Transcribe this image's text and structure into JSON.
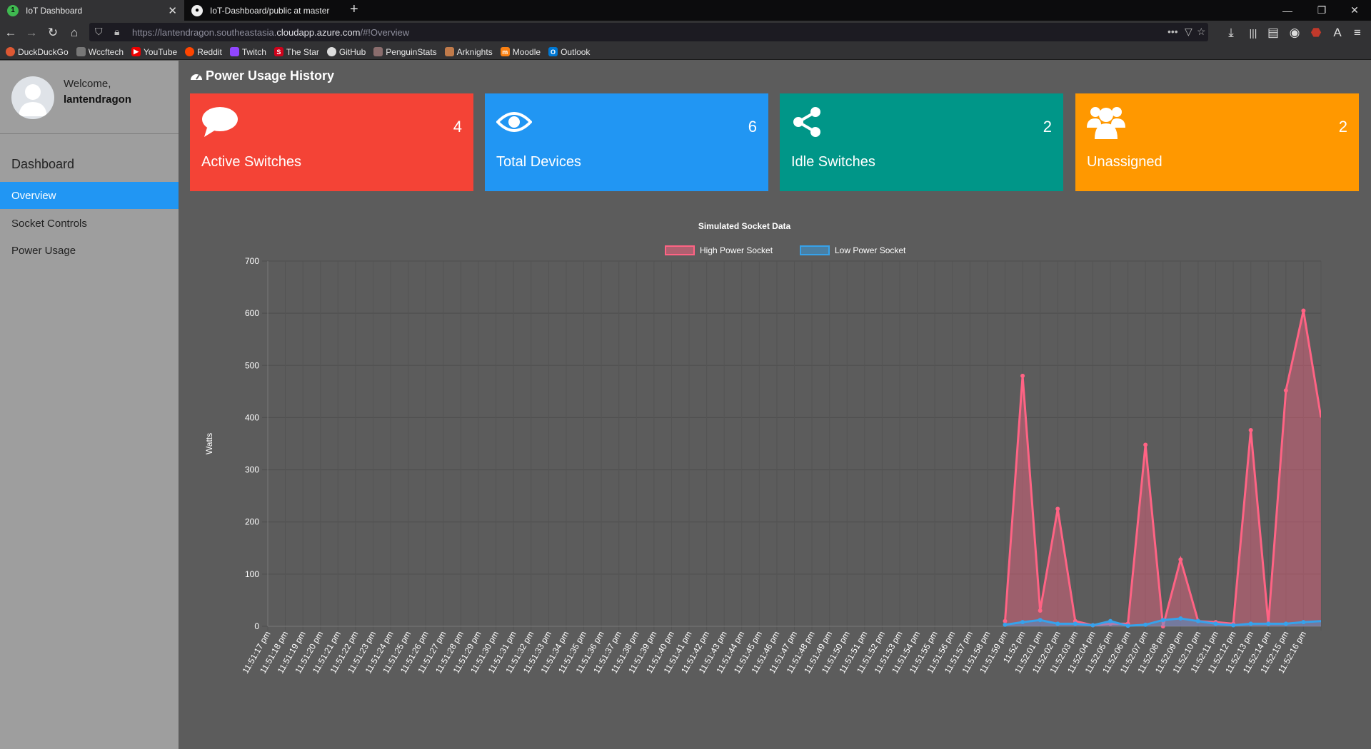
{
  "browser": {
    "tabs": [
      {
        "title": "IoT Dashboard",
        "active": true
      },
      {
        "title": "IoT-Dashboard/public at master",
        "active": false
      }
    ],
    "new_tab": "+",
    "url_prefix": "https://lantendragon.southeastasia.",
    "url_host": "cloudapp.azure.com",
    "url_suffix": "/#!Overview",
    "bookmarks": [
      "DuckDuckGo",
      "Wccftech",
      "YouTube",
      "Reddit",
      "Twitch",
      "The Star",
      "GitHub",
      "PenguinStats",
      "Arknights",
      "Moodle",
      "Outlook"
    ]
  },
  "sidebar": {
    "welcome": "Welcome,",
    "username": "lantendragon",
    "menu_title": "Dashboard",
    "items": [
      {
        "label": "Overview",
        "active": true
      },
      {
        "label": "Socket Controls",
        "active": false
      },
      {
        "label": "Power Usage",
        "active": false
      }
    ]
  },
  "main": {
    "title": "Power Usage History",
    "cards": [
      {
        "label": "Active Switches",
        "count": "4",
        "color": "#f44336",
        "icon": "speech-bubble-icon"
      },
      {
        "label": "Total Devices",
        "count": "6",
        "color": "#2196f3",
        "icon": "eye-icon"
      },
      {
        "label": "Idle Switches",
        "count": "2",
        "color": "#009688",
        "icon": "share-icon"
      },
      {
        "label": "Unassigned",
        "count": "2",
        "color": "#ff9800",
        "icon": "users-icon"
      }
    ]
  },
  "chart_data": {
    "type": "area",
    "title": "Simulated Socket Data",
    "ylabel": "Watts",
    "ylim": [
      0,
      700
    ],
    "yticks": [
      0,
      100,
      200,
      300,
      400,
      500,
      600,
      700
    ],
    "legend_position": "top-center",
    "x": [
      "11:51:17 pm",
      "11:51:18 pm",
      "11:51:19 pm",
      "11:51:20 pm",
      "11:51:21 pm",
      "11:51:22 pm",
      "11:51:23 pm",
      "11:51:24 pm",
      "11:51:25 pm",
      "11:51:26 pm",
      "11:51:27 pm",
      "11:51:28 pm",
      "11:51:29 pm",
      "11:51:30 pm",
      "11:51:31 pm",
      "11:51:32 pm",
      "11:51:33 pm",
      "11:51:34 pm",
      "11:51:35 pm",
      "11:51:36 pm",
      "11:51:37 pm",
      "11:51:38 pm",
      "11:51:39 pm",
      "11:51:40 pm",
      "11:51:41 pm",
      "11:51:42 pm",
      "11:51:43 pm",
      "11:51:44 pm",
      "11:51:45 pm",
      "11:51:46 pm",
      "11:51:47 pm",
      "11:51:48 pm",
      "11:51:49 pm",
      "11:51:50 pm",
      "11:51:51 pm",
      "11:51:52 pm",
      "11:51:53 pm",
      "11:51:54 pm",
      "11:51:55 pm",
      "11:51:56 pm",
      "11:51:57 pm",
      "11:51:58 pm",
      "11:51:59 pm",
      "11:52 pm",
      "11:52:01 pm",
      "11:52:02 pm",
      "11:52:03 pm",
      "11:52:04 pm",
      "11:52:05 pm",
      "11:52:06 pm",
      "11:52:07 pm",
      "11:52:08 pm",
      "11:52:09 pm",
      "11:52:10 pm",
      "11:52:11 pm",
      "11:52:12 pm",
      "11:52:13 pm",
      "11:52:14 pm",
      "11:52:15 pm",
      "11:52:16 pm",
      ""
    ],
    "series": [
      {
        "name": "High Power Socket",
        "color": "#ff6384",
        "values": [
          null,
          null,
          null,
          null,
          null,
          null,
          null,
          null,
          null,
          null,
          null,
          null,
          null,
          null,
          null,
          null,
          null,
          null,
          null,
          null,
          null,
          null,
          null,
          null,
          null,
          null,
          null,
          null,
          null,
          null,
          null,
          null,
          null,
          null,
          null,
          null,
          null,
          null,
          null,
          null,
          null,
          null,
          10,
          480,
          30,
          225,
          10,
          2,
          5,
          5,
          348,
          0,
          128,
          10,
          8,
          5,
          376,
          5,
          452,
          605,
          400
        ]
      },
      {
        "name": "Low Power Socket",
        "color": "#36a2eb",
        "values": [
          null,
          null,
          null,
          null,
          null,
          null,
          null,
          null,
          null,
          null,
          null,
          null,
          null,
          null,
          null,
          null,
          null,
          null,
          null,
          null,
          null,
          null,
          null,
          null,
          null,
          null,
          null,
          null,
          null,
          null,
          null,
          null,
          null,
          null,
          null,
          null,
          null,
          null,
          null,
          null,
          null,
          null,
          3,
          8,
          12,
          5,
          5,
          2,
          10,
          1,
          3,
          12,
          15,
          10,
          5,
          2,
          5,
          5,
          5,
          8,
          10
        ]
      }
    ]
  }
}
